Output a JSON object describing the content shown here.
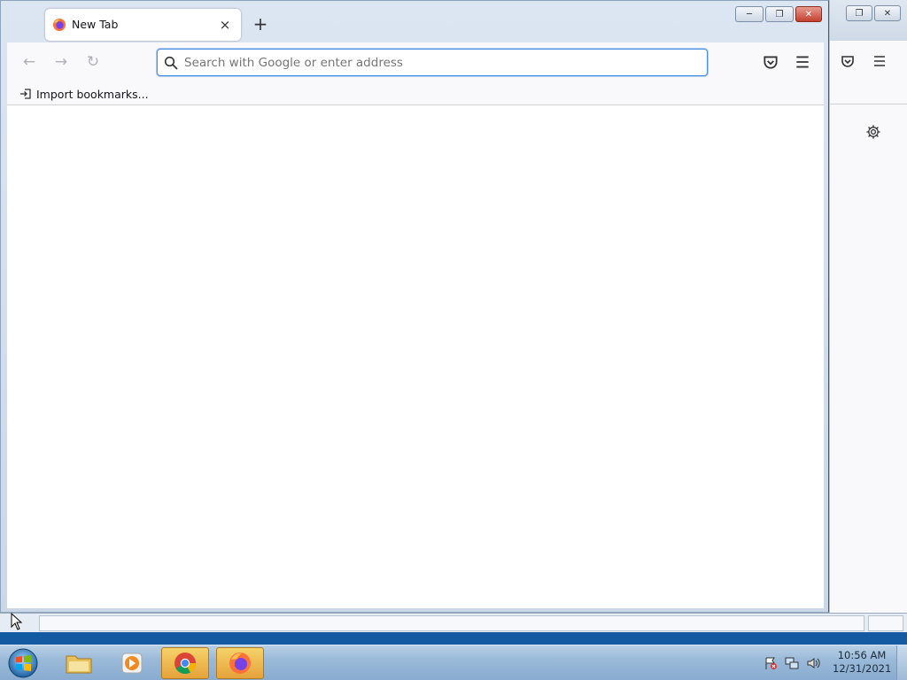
{
  "browser": {
    "tab": {
      "title": "New Tab",
      "close_symbol": "×"
    },
    "new_tab_symbol": "+",
    "window_buttons": {
      "minimize": "─",
      "restore": "❐",
      "close": "✕"
    },
    "nav": {
      "back": "←",
      "forward": "→",
      "reload": "↻"
    },
    "urlbar": {
      "placeholder": "Search with Google or enter address",
      "value": ""
    },
    "bookmarks_toolbar": {
      "import_label": "Import bookmarks..."
    }
  },
  "background_window": {
    "window_buttons": {
      "restore": "❐",
      "close": "✕"
    }
  },
  "taskbar": {
    "apps": [
      {
        "name": "Windows Explorer",
        "icon": "folder-icon"
      },
      {
        "name": "Windows Media Player",
        "icon": "media-player-icon"
      },
      {
        "name": "Google Chrome",
        "icon": "chrome-icon"
      },
      {
        "name": "Firefox",
        "icon": "firefox-icon"
      }
    ],
    "clock": {
      "time": "10:56 AM",
      "date": "12/31/2021"
    }
  }
}
